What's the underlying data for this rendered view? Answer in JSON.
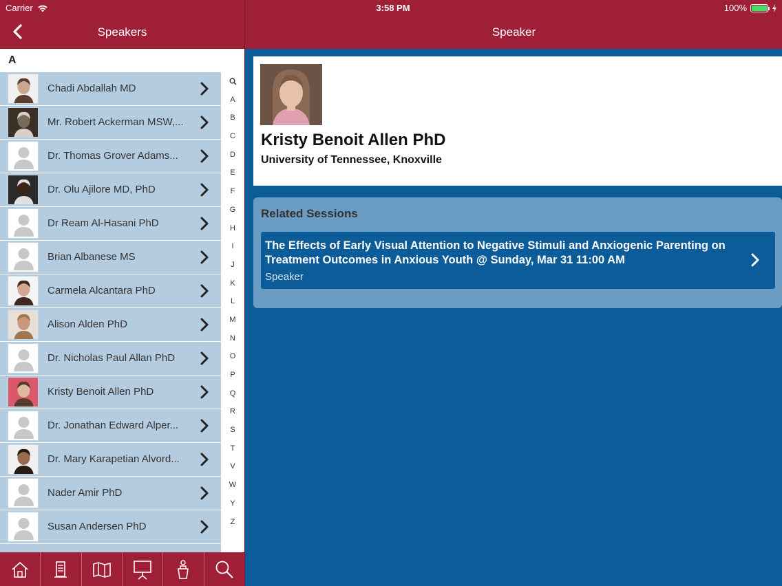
{
  "status": {
    "carrier": "Carrier",
    "time": "3:58 PM",
    "battery": "100%",
    "battery_level": 1.0
  },
  "left_nav": {
    "title": "Speakers",
    "section_header": "A"
  },
  "speakers": [
    {
      "name": "Chadi Abdallah MD",
      "avatar": "photo"
    },
    {
      "name": "Mr. Robert Ackerman MSW,...",
      "avatar": "photo"
    },
    {
      "name": "Dr. Thomas Grover Adams...",
      "avatar": "placeholder"
    },
    {
      "name": "Dr. Olu Ajilore MD, PhD",
      "avatar": "photo"
    },
    {
      "name": "Dr Ream Al-Hasani PhD",
      "avatar": "placeholder"
    },
    {
      "name": "Brian Albanese MS",
      "avatar": "placeholder"
    },
    {
      "name": "Carmela Alcantara PhD",
      "avatar": "photo"
    },
    {
      "name": "Alison Alden PhD",
      "avatar": "photo"
    },
    {
      "name": "Dr. Nicholas Paul Allan PhD",
      "avatar": "placeholder"
    },
    {
      "name": "Kristy Benoit Allen PhD",
      "avatar": "photo"
    },
    {
      "name": "Dr. Jonathan Edward Alper...",
      "avatar": "placeholder"
    },
    {
      "name": "Dr. Mary Karapetian Alvord...",
      "avatar": "photo"
    },
    {
      "name": "Nader Amir PhD",
      "avatar": "placeholder"
    },
    {
      "name": "Susan Andersen PhD",
      "avatar": "placeholder"
    }
  ],
  "index_letters": [
    "Q",
    "A",
    "B",
    "C",
    "D",
    "E",
    "F",
    "G",
    "H",
    "I",
    "J",
    "K",
    "L",
    "M",
    "N",
    "O",
    "P",
    "Q",
    "R",
    "S",
    "T",
    "V",
    "W",
    "Y",
    "Z"
  ],
  "tabs": [
    {
      "icon": "home-icon"
    },
    {
      "icon": "exhibitor-booth-icon"
    },
    {
      "icon": "map-icon"
    },
    {
      "icon": "presentation-icon"
    },
    {
      "icon": "speaker-podium-icon"
    },
    {
      "icon": "search-icon"
    }
  ],
  "detail": {
    "title": "Speaker",
    "name": "Kristy Benoit Allen PhD",
    "organization": "University of Tennessee, Knoxville",
    "related_sessions_label": "Related Sessions",
    "sessions": [
      {
        "title": "The Effects of Early Visual Attention to Negative Stimuli and Anxiogenic Parenting on Treatment Outcomes in Anxious Youth @ Sunday, Mar 31 11:00 AM",
        "role": "Speaker"
      }
    ]
  },
  "colors": {
    "header": "#9e1f36",
    "list_row": "#b4cce0",
    "detail_bg": "#0d5c9a",
    "sessions_panel": "#6a9cc4"
  }
}
